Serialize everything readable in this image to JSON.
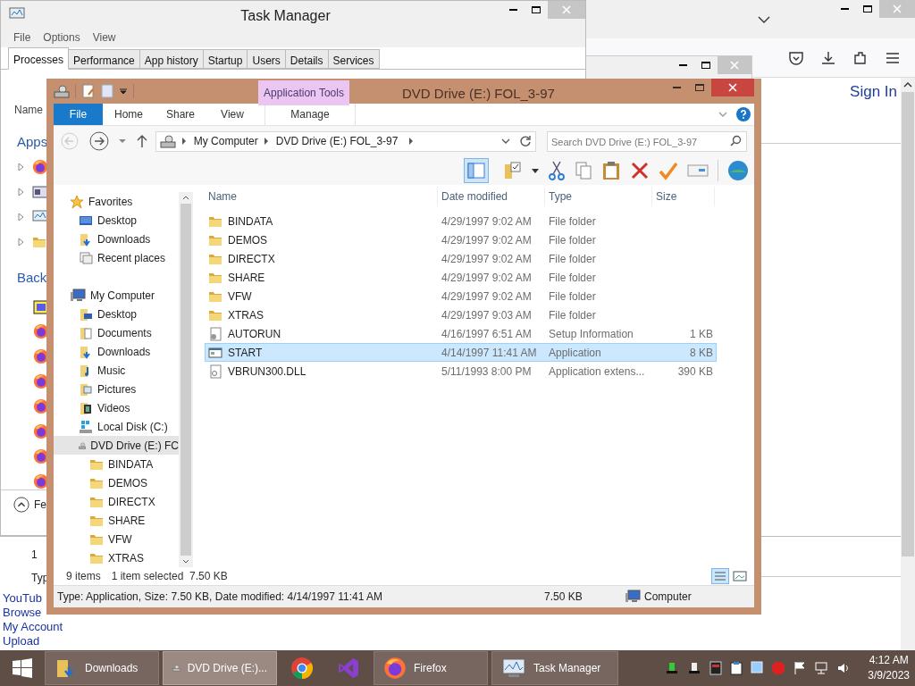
{
  "browser": {
    "sign_in": "Sign In",
    "links": [
      "YouTub",
      "Browse",
      "My Account",
      "Upload"
    ]
  },
  "background_window": {
    "cell": "1",
    "column": "Typ"
  },
  "task_manager": {
    "title": "Task Manager",
    "menu": [
      "File",
      "Options",
      "View"
    ],
    "tabs": [
      {
        "label": "Processes",
        "selected": true
      },
      {
        "label": "Performance",
        "selected": false
      },
      {
        "label": "App history",
        "selected": false
      },
      {
        "label": "Startup",
        "selected": false
      },
      {
        "label": "Users",
        "selected": false
      },
      {
        "label": "Details",
        "selected": false
      },
      {
        "label": "Services",
        "selected": false
      }
    ],
    "column": "Name",
    "groups": [
      "Apps",
      "Back"
    ],
    "footer": "Fe"
  },
  "explorer": {
    "title": "DVD Drive (E:) FOL_3-97",
    "ribbon_tabs": [
      {
        "label": "File",
        "kind": "file"
      },
      {
        "label": "Home",
        "kind": "tab"
      },
      {
        "label": "Share",
        "kind": "tab"
      },
      {
        "label": "View",
        "kind": "tab"
      }
    ],
    "context": {
      "title": "Application Tools",
      "tabs": [
        "Manage"
      ]
    },
    "breadcrumb": [
      "My Computer",
      "DVD Drive (E:) FOL_3-97"
    ],
    "search": {
      "placeholder": "Search DVD Drive (E:) FOL_3-97"
    },
    "nav": [
      {
        "label": "Favorites",
        "kind": "star",
        "selected": false,
        "children": [
          {
            "label": "Desktop",
            "kind": "desktop",
            "selected": false
          },
          {
            "label": "Downloads",
            "kind": "downloads",
            "selected": false
          },
          {
            "label": "Recent places",
            "kind": "recent",
            "selected": false
          }
        ]
      },
      {
        "label": "My Computer",
        "kind": "computer",
        "selected": false,
        "children": [
          {
            "label": "Desktop",
            "kind": "desktop-folder",
            "selected": false
          },
          {
            "label": "Documents",
            "kind": "documents",
            "selected": false
          },
          {
            "label": "Downloads",
            "kind": "downloads",
            "selected": false
          },
          {
            "label": "Music",
            "kind": "music",
            "selected": false
          },
          {
            "label": "Pictures",
            "kind": "pictures",
            "selected": false
          },
          {
            "label": "Videos",
            "kind": "videos",
            "selected": false
          },
          {
            "label": "Local Disk (C:)",
            "kind": "disk",
            "selected": false
          },
          {
            "label": "DVD Drive (E:) FC",
            "kind": "dvd",
            "selected": true,
            "children": [
              {
                "label": "BINDATA",
                "kind": "folder",
                "selected": false
              },
              {
                "label": "DEMOS",
                "kind": "folder",
                "selected": false
              },
              {
                "label": "DIRECTX",
                "kind": "folder",
                "selected": false
              },
              {
                "label": "SHARE",
                "kind": "folder",
                "selected": false
              },
              {
                "label": "VFW",
                "kind": "folder",
                "selected": false
              },
              {
                "label": "XTRAS",
                "kind": "folder",
                "selected": false
              }
            ]
          }
        ]
      }
    ],
    "columns": [
      "Name",
      "Date modified",
      "Type",
      "Size"
    ],
    "rows": [
      {
        "name": "BINDATA",
        "date": "4/29/1997 9:02 AM",
        "type": "File folder",
        "kind": "folder",
        "selected": false
      },
      {
        "name": "DEMOS",
        "date": "4/29/1997 9:02 AM",
        "type": "File folder",
        "kind": "folder",
        "selected": false
      },
      {
        "name": "DIRECTX",
        "date": "4/29/1997 9:02 AM",
        "type": "File folder",
        "kind": "folder",
        "selected": false
      },
      {
        "name": "SHARE",
        "date": "4/29/1997 9:02 AM",
        "type": "File folder",
        "kind": "folder",
        "selected": false
      },
      {
        "name": "VFW",
        "date": "4/29/1997 9:02 AM",
        "type": "File folder",
        "kind": "folder",
        "selected": false
      },
      {
        "name": "XTRAS",
        "date": "4/29/1997 9:03 AM",
        "type": "File folder",
        "kind": "folder",
        "selected": false
      },
      {
        "name": "AUTORUN",
        "date": "4/16/1997 6:51 AM",
        "type": "Setup Information",
        "size": "1 KB",
        "kind": "settings",
        "selected": false
      },
      {
        "name": "START",
        "date": "4/14/1997 11:41 AM",
        "type": "Application",
        "size": "8 KB",
        "kind": "app",
        "selected": true
      },
      {
        "name": "VBRUN300.DLL",
        "date": "5/11/1993 8:00 PM",
        "type": "Application extens...",
        "size": "390 KB",
        "kind": "dll",
        "selected": false
      }
    ],
    "status": {
      "count": "9 items",
      "selection": "1 item selected  7.50 KB"
    },
    "details": {
      "text": "Type: Application, Size: 7.50 KB, Date modified: 4/14/1997 11:41 AM",
      "size": "7.50 KB",
      "location": "Computer"
    }
  },
  "taskbar": {
    "items": [
      {
        "label": "Downloads",
        "kind": "folder",
        "selected": false
      },
      {
        "label": "DVD Drive (E:)...",
        "kind": "dvd",
        "selected": true
      },
      {
        "kind": "chrome",
        "selected": false
      },
      {
        "kind": "studio",
        "selected": false
      },
      {
        "label": "Firefox",
        "kind": "firefox",
        "selected": false
      },
      {
        "label": "Task Manager",
        "kind": "taskmgr",
        "selected": false
      }
    ],
    "time": "4:12 AM",
    "date": "3/9/2023"
  }
}
